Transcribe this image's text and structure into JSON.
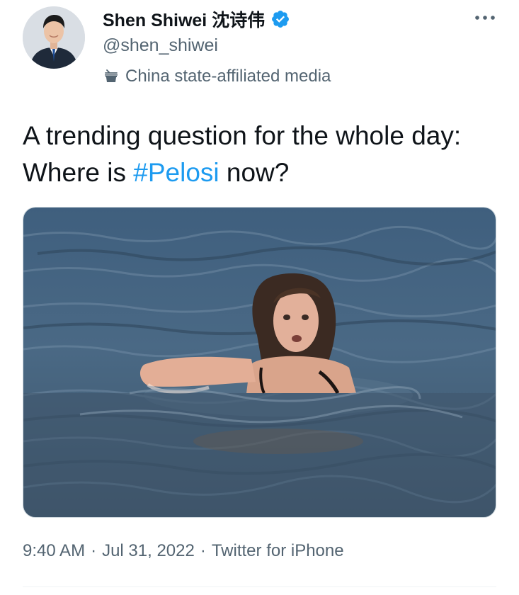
{
  "author": {
    "display_name": "Shen Shiwei 沈诗伟",
    "handle": "@shen_shiwei",
    "verified": true,
    "affiliation_label": "China state-affiliated media"
  },
  "tweet": {
    "text_before": "A trending question for the whole day: Where is ",
    "hashtag": "#Pelosi",
    "text_after": " now?"
  },
  "meta": {
    "time": "9:40 AM",
    "date": "Jul 31, 2022",
    "source": "Twitter for iPhone",
    "separator": "·"
  },
  "icons": {
    "more": "more-horizontal-icon",
    "verified": "verified-badge-icon",
    "affiliation": "government-building-icon"
  },
  "colors": {
    "accent": "#1d9bf0",
    "secondary_text": "#536471",
    "primary_text": "#0f1419"
  }
}
